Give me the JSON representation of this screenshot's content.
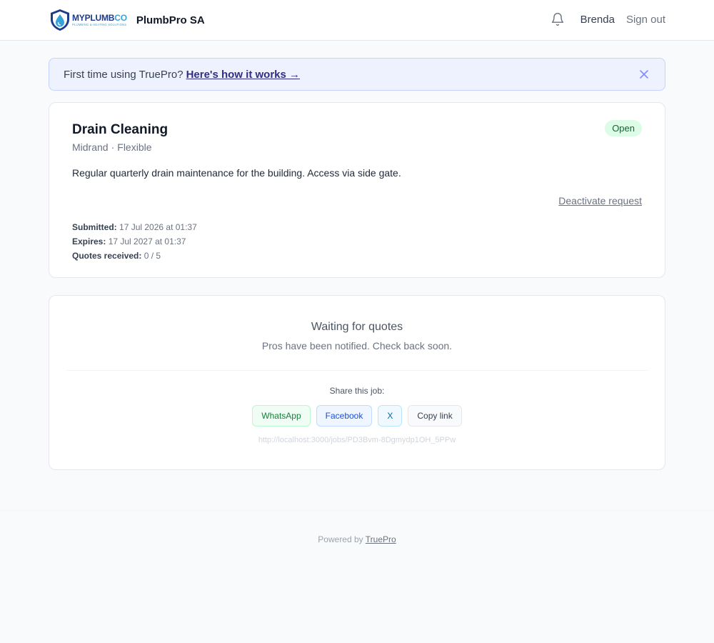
{
  "header": {
    "logo_word_a": "MYPLUMB",
    "logo_word_b": "CO",
    "logo_tagline": "PLUMBING & HEATING SOLUTIONS",
    "company_name": "PlumbPro SA",
    "user_name": "Brenda",
    "sign_out": "Sign out",
    "icons": [
      "bell-icon"
    ]
  },
  "banner": {
    "text": "First time using TruePro?",
    "link": "Here's how it works →",
    "close_icon": "close-icon"
  },
  "job": {
    "title": "Drain Cleaning",
    "location": "Midrand",
    "separator": "·",
    "timing": "Flexible",
    "status": "Open",
    "description": "Regular quarterly drain maintenance for the building. Access via side gate.",
    "deactivate": "Deactivate request",
    "submitted_label": "Submitted:",
    "submitted_value": "17 Jul 2026 at 01:37",
    "expires_label": "Expires:",
    "expires_value": "17 Jul 2027 at 01:37",
    "quotes_label": "Quotes received:",
    "quotes_value": "0 / 5"
  },
  "quotes": {
    "title": "Waiting for quotes",
    "subtitle": "Pros have been notified. Check back soon.",
    "share_label": "Share this job:",
    "buttons": {
      "whatsapp": "WhatsApp",
      "facebook": "Facebook",
      "x": "X",
      "copy": "Copy link"
    },
    "url": "http://localhost:3000/jobs/PD3Bvm-8Dgmydp1OH_5PPw"
  },
  "footer": {
    "text": "Powered by",
    "link": "TruePro"
  },
  "colors": {
    "badge_open_bg": "#dcfce7",
    "badge_open_text": "#166534",
    "banner_bg": "#eef2ff",
    "brand_dark": "#1e3a8a",
    "brand_light": "#38a3d8"
  }
}
